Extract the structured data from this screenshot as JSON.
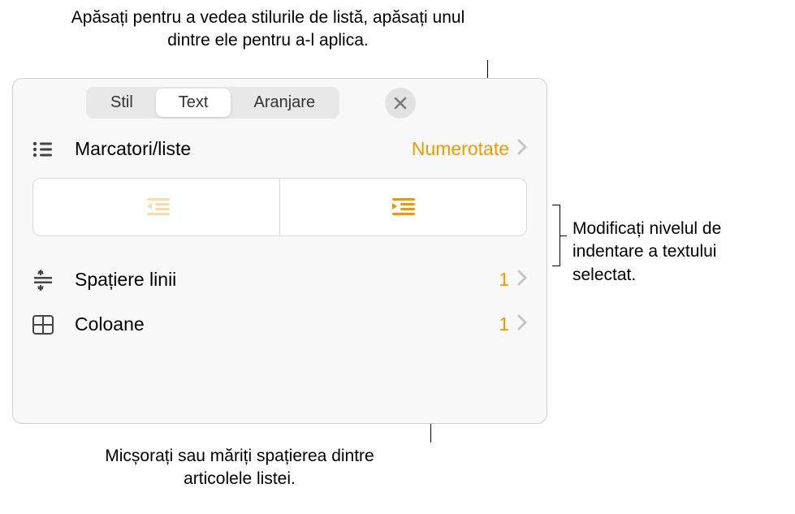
{
  "callouts": {
    "top": "Apăsați pentru a vedea stilurile de listă, apăsați unul dintre ele pentru a-l aplica.",
    "right": "Modificați nivelul de indentare a textului selectat.",
    "bottom": "Micșorați sau măriți spațierea dintre articolele listei."
  },
  "tabs": {
    "style": "Stil",
    "text": "Text",
    "arrange": "Aranjare"
  },
  "rows": {
    "bullets": {
      "label": "Marcatori/liste",
      "value": "Numerotate"
    },
    "lineSpacing": {
      "label": "Spațiere linii",
      "value": "1"
    },
    "columns": {
      "label": "Coloane",
      "value": "1"
    }
  }
}
